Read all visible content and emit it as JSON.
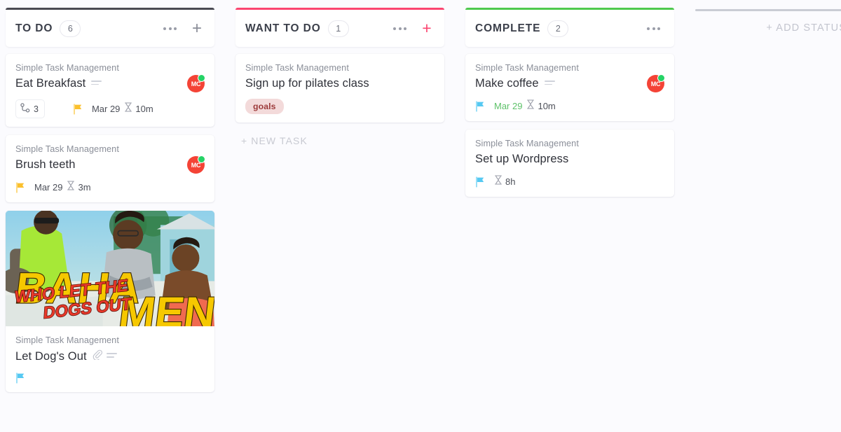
{
  "board": {
    "columns": [
      {
        "id": "to-do",
        "title": "TO DO",
        "count": "6",
        "accent": "#4a4a52",
        "has_add": true,
        "add_color": "#8a8d98",
        "cards": [
          {
            "list": "Simple Task Management",
            "title": "Eat Breakfast",
            "has_description_icon": true,
            "has_attachment_icon": false,
            "avatar": {
              "initials": "MC",
              "color": "#f44336",
              "presence_color": "#25d366"
            },
            "subtasks": "3",
            "subtask_icon": "subtask-tree-icon",
            "flag": "yellow",
            "flag_color": "#fbc02d",
            "date": "Mar 29",
            "date_color": "#4c4f58",
            "time": "10m",
            "time_icon": "hourglass-icon"
          },
          {
            "list": "Simple Task Management",
            "title": "Brush teeth",
            "has_description_icon": false,
            "has_attachment_icon": false,
            "avatar": {
              "initials": "MC",
              "color": "#f44336",
              "presence_color": "#25d366"
            },
            "flag": "yellow",
            "flag_color": "#fbc02d",
            "date": "Mar 29",
            "date_color": "#4c4f58",
            "time": "3m",
            "time_icon": "hourglass-icon"
          },
          {
            "list": "Simple Task Management",
            "title": "Let Dog's Out",
            "has_description_icon": true,
            "has_attachment_icon": true,
            "cover": {
              "alt": "baha-men-who-let-the-dogs-out-cover",
              "headline": "BAHA MEN",
              "subline": "WHO LET THE DOGS OUT"
            },
            "flag": "blue",
            "flag_color": "#56c9f2"
          }
        ]
      },
      {
        "id": "want-to-do",
        "title": "WANT TO DO",
        "count": "1",
        "accent": "#fb4570",
        "has_add": true,
        "add_color": "#fb4570",
        "new_task_label": "+ NEW TASK",
        "cards": [
          {
            "list": "Simple Task Management",
            "title": "Sign up for pilates class",
            "has_description_icon": false,
            "has_attachment_icon": false,
            "tag": "goals",
            "tag_bg": "#f3dada",
            "tag_color": "#9d3b3b"
          }
        ]
      },
      {
        "id": "complete",
        "title": "COMPLETE",
        "count": "2",
        "accent": "#4ec94e",
        "has_add": false,
        "cards": [
          {
            "list": "Simple Task Management",
            "title": "Make coffee",
            "has_description_icon": true,
            "has_attachment_icon": false,
            "avatar": {
              "initials": "MC",
              "color": "#f44336",
              "presence_color": "#25d366"
            },
            "flag": "blue",
            "flag_color": "#56c9f2",
            "date": "Mar 29",
            "date_color": "#5ec26a",
            "time": "10m",
            "time_icon": "hourglass-icon"
          },
          {
            "list": "Simple Task Management",
            "title": "Set up Wordpress",
            "has_description_icon": false,
            "has_attachment_icon": false,
            "flag": "blue",
            "flag_color": "#56c9f2",
            "time": "8h",
            "time_icon": "hourglass-icon"
          }
        ]
      }
    ],
    "add_status_label": "+ ADD STATUS"
  }
}
